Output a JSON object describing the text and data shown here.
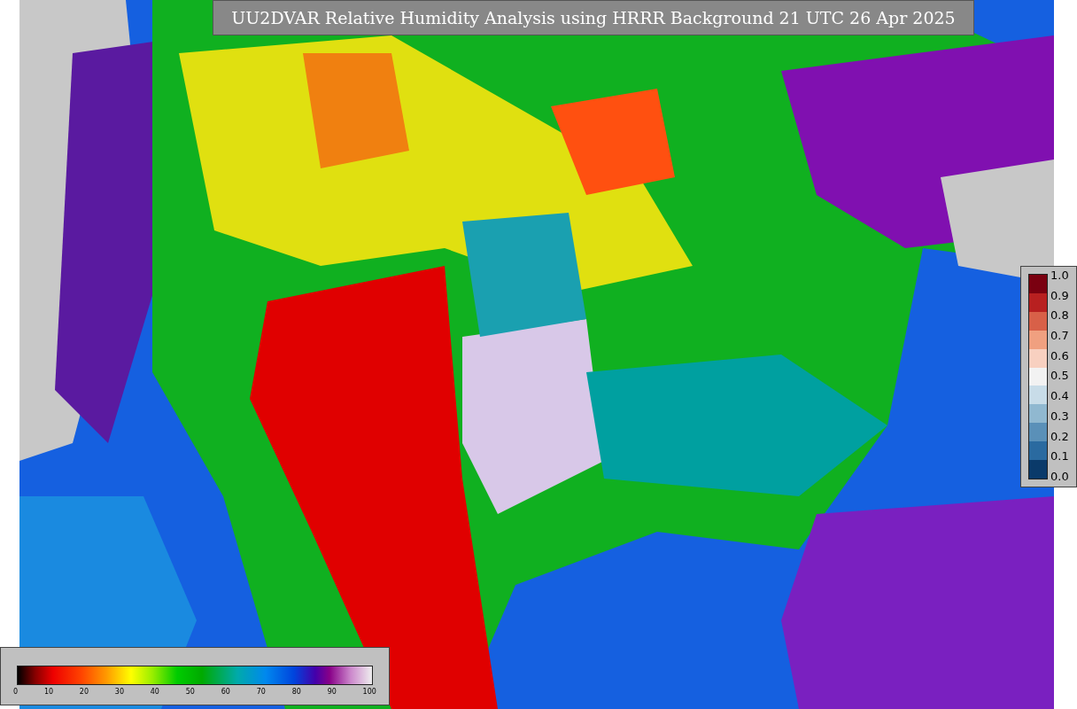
{
  "title": "UU2DVAR Relative Humidity Analysis using HRRR Background 21 UTC 26 Apr 2025",
  "side_colorbar": {
    "ticks": [
      "1.0",
      "0.9",
      "0.8",
      "0.7",
      "0.6",
      "0.5",
      "0.4",
      "0.3",
      "0.2",
      "0.1",
      "0.0"
    ]
  },
  "bottom_colorbar": {
    "ticks": [
      "0",
      "10",
      "20",
      "30",
      "40",
      "50",
      "60",
      "70",
      "80",
      "90",
      "100"
    ]
  }
}
